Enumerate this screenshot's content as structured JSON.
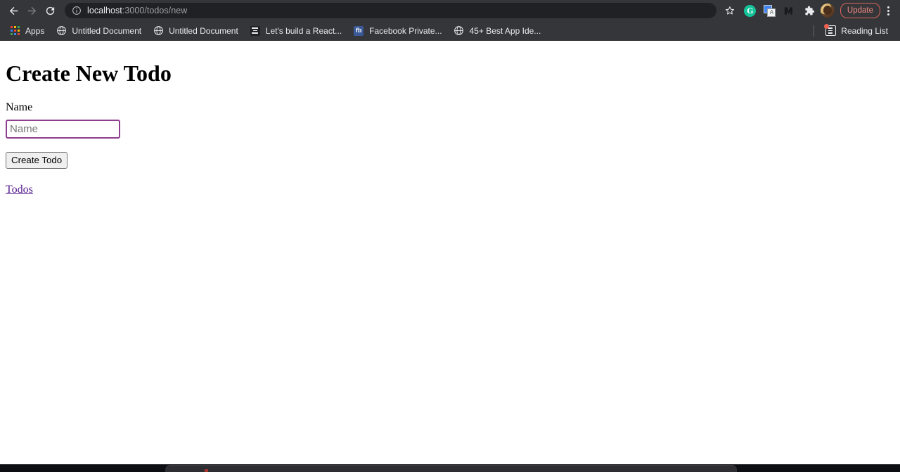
{
  "browser": {
    "nav": {
      "back_label": "Back",
      "forward_label": "Forward",
      "reload_label": "Reload"
    },
    "omnibox": {
      "site_info_icon": "info-circle-icon",
      "url_host": "localhost",
      "url_path": ":3000/todos/new",
      "full_url": "localhost:3000/todos/new"
    },
    "actions": {
      "bookmark_star": "star-icon",
      "grammarly_label": "G",
      "translate_label": "文",
      "medium_label": "M",
      "extensions_label": "Extensions",
      "profile_label": "Profile",
      "update_label": "Update",
      "menu_label": "Customize and control Google Chrome"
    }
  },
  "bookmarks": {
    "items": [
      {
        "label": "Apps",
        "icon": "apps-grid-icon"
      },
      {
        "label": "Untitled Document",
        "icon": "globe-icon"
      },
      {
        "label": "Untitled Document",
        "icon": "globe-icon"
      },
      {
        "label": "Let's build a React...",
        "icon": "article-lines-icon"
      },
      {
        "label": "Facebook Private...",
        "icon": "facebook-icon"
      },
      {
        "label": "45+ Best App Ide...",
        "icon": "globe-icon"
      }
    ],
    "reading_list": {
      "label": "Reading List",
      "icon": "reading-list-icon"
    }
  },
  "page": {
    "title": "Create New Todo",
    "form": {
      "name_label": "Name",
      "name_value": "",
      "name_placeholder": "Name",
      "submit_label": "Create Todo"
    },
    "todos_link_label": "Todos"
  },
  "colors": {
    "chrome_bg": "#35363a",
    "omnibox_bg": "#202124",
    "input_border": "#8e3f8e",
    "visited_link": "#551a8b",
    "update_accent": "#f28b82",
    "page_bg": "#ffffff"
  }
}
